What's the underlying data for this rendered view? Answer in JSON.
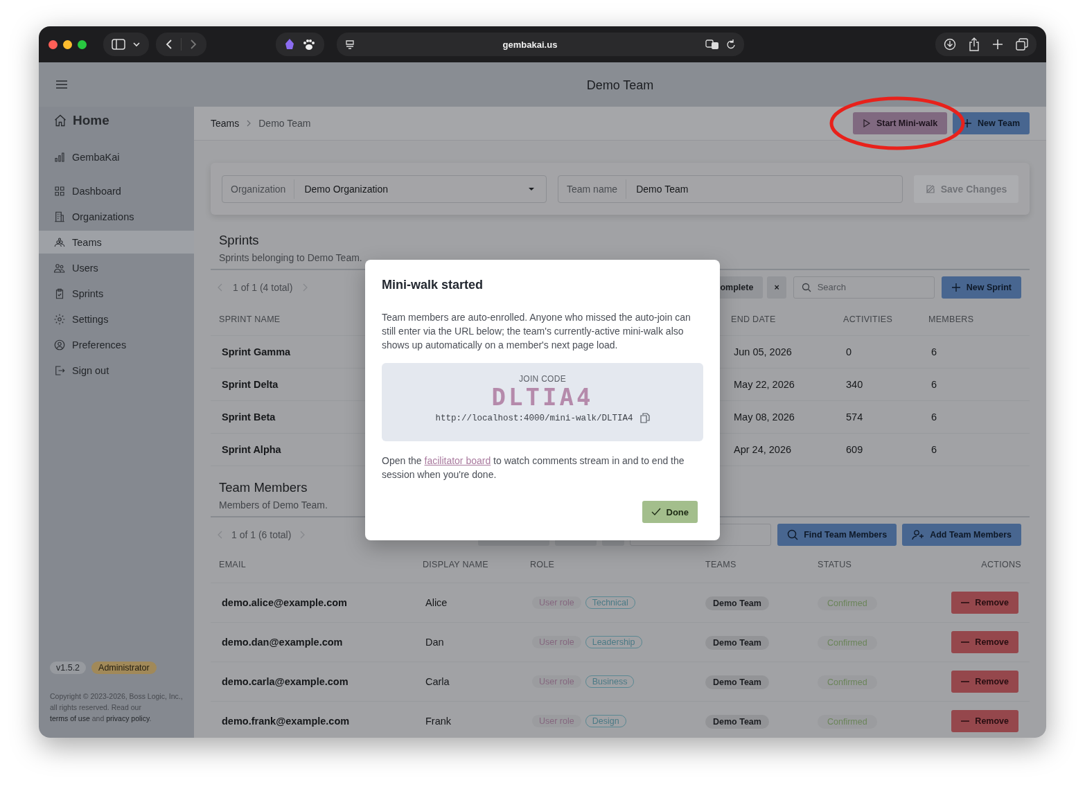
{
  "browser": {
    "url": "gembakai.us"
  },
  "header": {
    "title": "Demo Team"
  },
  "sidebar": {
    "home": "Home",
    "items": [
      {
        "label": "GembaKai",
        "selected": false
      },
      {
        "label": "Dashboard",
        "selected": false
      },
      {
        "label": "Organizations",
        "selected": false
      },
      {
        "label": "Teams",
        "selected": true
      },
      {
        "label": "Users",
        "selected": false
      },
      {
        "label": "Sprints",
        "selected": false
      },
      {
        "label": "Settings",
        "selected": false
      },
      {
        "label": "Preferences",
        "selected": false
      },
      {
        "label": "Sign out",
        "selected": false
      }
    ],
    "version": "v1.5.2",
    "role": "Administrator",
    "copyright": {
      "text": "Copyright © 2023-2026, Boss Logic, Inc., all rights reserved. Read our",
      "terms_link": "terms of use",
      "middle": "and",
      "privacy_link": "privacy policy",
      "end": "."
    }
  },
  "breadcrumb": [
    "Teams",
    "Demo Team"
  ],
  "actions": {
    "start_button": "Start Mini-walk",
    "new_team_button": "New Team"
  },
  "form": {
    "organization": {
      "label": "Organization",
      "value": "Demo Organization"
    },
    "team_name": {
      "label": "Team name",
      "value": "Demo Team"
    },
    "save_button": {
      "label": "Save Changes",
      "disabled": true
    }
  },
  "sprints": {
    "title": "Sprints",
    "subtitle": "Sprints belonging to Demo Team.",
    "pager": "1 of 1 (4 total)",
    "complete_button": "omplete",
    "clear_button": "×",
    "search": {
      "placeholder": "Search"
    },
    "new_button": "New Sprint",
    "columns": [
      "SPRINT NAME",
      "END DATE",
      "ACTIVITIES",
      "MEMBERS"
    ],
    "rows": [
      {
        "name": "Sprint Gamma",
        "end_date": "Jun 05, 2026",
        "activities": "0",
        "members": "6"
      },
      {
        "name": "Sprint Delta",
        "end_date": "May 22, 2026",
        "activities": "340",
        "members": "6"
      },
      {
        "name": "Sprint Beta",
        "end_date": "May 08, 2026",
        "activities": "574",
        "members": "6"
      },
      {
        "name": "Sprint Alpha",
        "end_date": "Apr 24, 2026",
        "activities": "609",
        "members": "6"
      }
    ]
  },
  "members": {
    "title": "Team Members",
    "subtitle": "Members of Demo Team.",
    "pager": "1 of 1 (6 total)",
    "find_button": "Find Team Members",
    "add_button": "Add Team Members",
    "columns": [
      "EMAIL",
      "DISPLAY NAME",
      "ROLE",
      "TEAMS",
      "STATUS",
      "ACTIONS"
    ],
    "rows": [
      {
        "email": "demo.alice@example.com",
        "display_name": "Alice",
        "role": "User role",
        "tag": "Technical",
        "team": "Demo Team",
        "status": "Confirmed",
        "action": "Remove"
      },
      {
        "email": "demo.dan@example.com",
        "display_name": "Dan",
        "role": "User role",
        "tag": "Leadership",
        "team": "Demo Team",
        "status": "Confirmed",
        "action": "Remove"
      },
      {
        "email": "demo.carla@example.com",
        "display_name": "Carla",
        "role": "User role",
        "tag": "Business",
        "team": "Demo Team",
        "status": "Confirmed",
        "action": "Remove"
      },
      {
        "email": "demo.frank@example.com",
        "display_name": "Frank",
        "role": "User role",
        "tag": "Design",
        "team": "Demo Team",
        "status": "Confirmed",
        "action": "Remove"
      }
    ]
  },
  "modal": {
    "title": "Mini-walk started",
    "body": "Team members are auto-enrolled. Anyone who missed the auto-join can still enter via the URL below; the team's currently-active mini-walk also shows up automatically on a member's next page load.",
    "join_label": "JOIN CODE",
    "code": "DLTIA4",
    "url": "http://localhost:4000/mini-walk/DLTIA4",
    "footer_before": "Open the",
    "footer_link": "facilitator board",
    "footer_after": "to watch comments stream in and to end the session when you're done.",
    "done_button": "Done"
  }
}
